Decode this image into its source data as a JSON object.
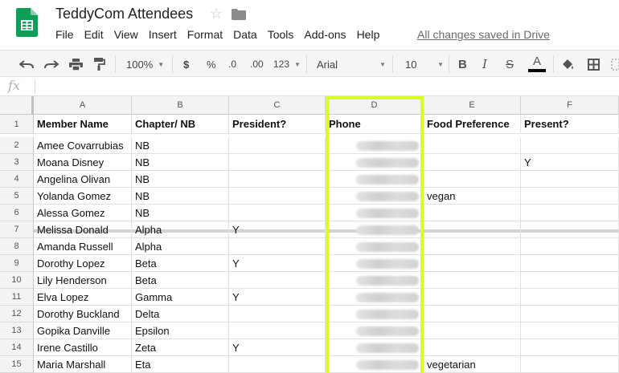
{
  "app": {
    "title": "TeddyCom Attendees",
    "save_status": "All changes saved in Drive",
    "menu": [
      "File",
      "Edit",
      "View",
      "Insert",
      "Format",
      "Data",
      "Tools",
      "Add-ons",
      "Help"
    ]
  },
  "toolbar": {
    "zoom": "100%",
    "currency": "$",
    "percent": "%",
    "decrease_decimals": ".0",
    "increase_decimals": ".00",
    "more_formats": "123",
    "font": "Arial",
    "font_size": "10",
    "bold": "B",
    "italic": "I",
    "strikethrough": "S",
    "text_color_letter": "A"
  },
  "formula_bar": {
    "label": "fx",
    "value": ""
  },
  "grid": {
    "columns": [
      "A",
      "B",
      "C",
      "D",
      "E",
      "F"
    ],
    "highlighted_column": "D",
    "rows": [
      {
        "num": "1",
        "cells": [
          "Member Name",
          "Chapter/ NB",
          "President?",
          "Phone",
          "Food Preference",
          "Present?"
        ]
      },
      {
        "num": "2",
        "cells": [
          "Amee Covarrubias",
          "NB",
          "",
          "",
          "",
          ""
        ]
      },
      {
        "num": "3",
        "cells": [
          "Moana Disney",
          "NB",
          "",
          "",
          "",
          "Y"
        ]
      },
      {
        "num": "4",
        "cells": [
          "Angelina Olivan",
          "NB",
          "",
          "",
          "",
          ""
        ]
      },
      {
        "num": "5",
        "cells": [
          "Yolanda Gomez",
          "NB",
          "",
          "",
          "vegan",
          ""
        ]
      },
      {
        "num": "6",
        "cells": [
          "Alessa Gomez",
          "NB",
          "",
          "",
          "",
          ""
        ]
      },
      {
        "num": "7",
        "cells": [
          "Melissa Donald",
          "Alpha",
          "Y",
          "",
          "",
          ""
        ]
      },
      {
        "num": "8",
        "cells": [
          "Amanda Russell",
          "Alpha",
          "",
          "",
          "",
          ""
        ]
      },
      {
        "num": "9",
        "cells": [
          "Dorothy Lopez",
          "Beta",
          "Y",
          "",
          "",
          ""
        ]
      },
      {
        "num": "10",
        "cells": [
          "Lily Henderson",
          "Beta",
          "",
          "",
          "",
          ""
        ]
      },
      {
        "num": "11",
        "cells": [
          "Elva Lopez",
          "Gamma",
          "Y",
          "",
          "",
          ""
        ]
      },
      {
        "num": "12",
        "cells": [
          "Dorothy Buckland",
          "Delta",
          "",
          "",
          "",
          ""
        ]
      },
      {
        "num": "13",
        "cells": [
          "Gopika Danville",
          "Epsilon",
          "",
          "",
          "",
          ""
        ]
      },
      {
        "num": "14",
        "cells": [
          "Irene Castillo",
          "Zeta",
          "Y",
          "",
          "",
          ""
        ]
      },
      {
        "num": "15",
        "cells": [
          "Maria Marshall",
          "Eta",
          "",
          "",
          "vegetarian",
          ""
        ]
      }
    ]
  },
  "colors": {
    "sheets_green": "#0f9d58",
    "column_highlight": "#d9ff1f",
    "header_bg": "#f3f3f3",
    "toolbar_bg": "#f5f5f5"
  },
  "icons": {
    "logo": "google-sheets-logo",
    "star": "star-outline-icon",
    "folder": "folder-icon",
    "undo": "undo-icon",
    "redo": "redo-icon",
    "print": "print-icon",
    "paint_format": "paint-format-icon",
    "fill_color": "fill-color-icon",
    "borders": "borders-icon"
  }
}
